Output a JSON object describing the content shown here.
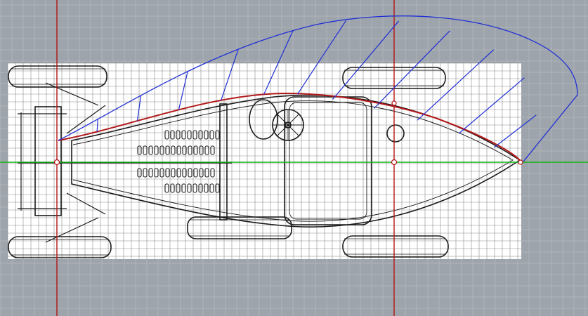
{
  "viewport": {
    "view_name": "",
    "background_color": "#9ea4ab",
    "grid_line_color": "#b4b9bf",
    "x_axis_color": "#12b312",
    "y_axis_color": "#b31212"
  },
  "drawing": {
    "subject": "race-car-top-view-blueprint",
    "paper_color": "#ffffff",
    "ink_color": "#1a1a1a"
  },
  "curves": {
    "profile_curve_color": "#b31818",
    "offset_curve_color": "#1f2fd6",
    "comb_lines": 11
  },
  "reference_points": {
    "color": "#ffffff"
  }
}
